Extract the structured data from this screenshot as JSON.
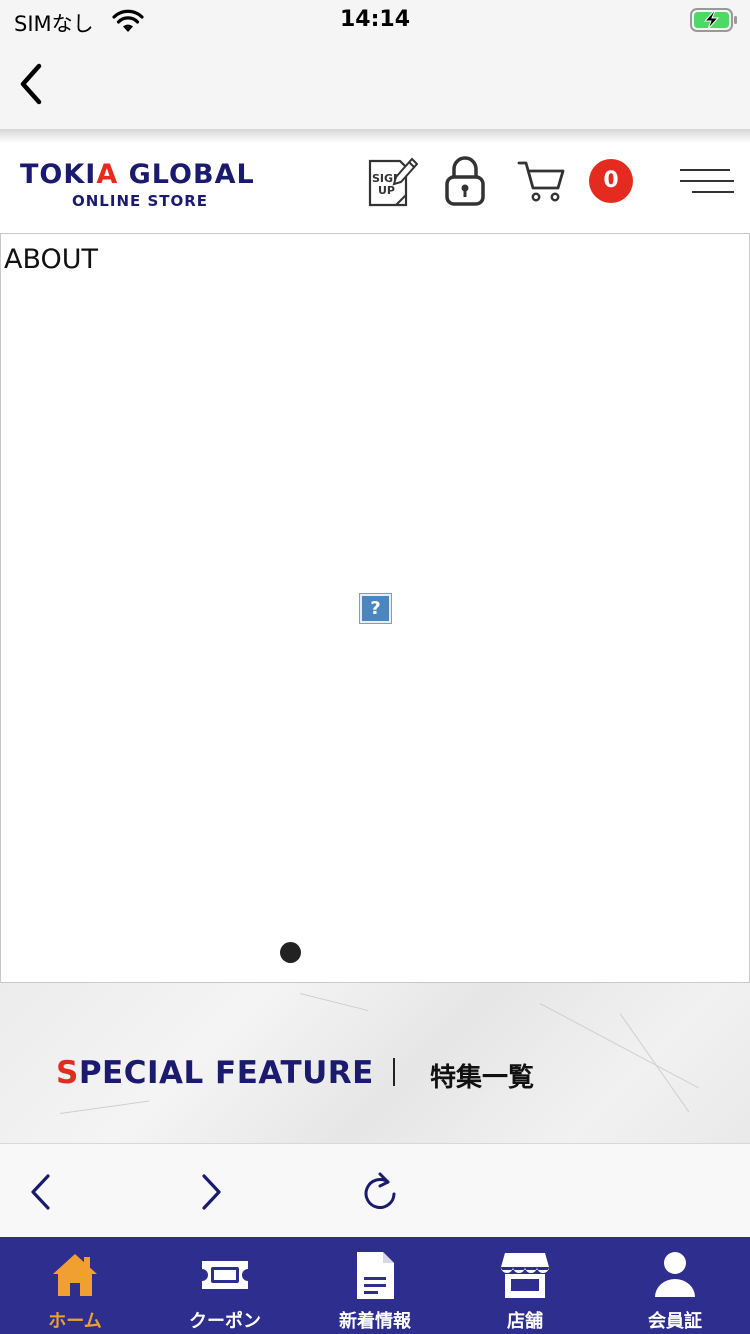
{
  "status_bar": {
    "carrier": "SIMなし",
    "time": "14:14",
    "wifi_icon": "wifi-icon",
    "battery_icon": "battery-charging-icon"
  },
  "nav": {
    "back_icon": "chevron-left-icon"
  },
  "header": {
    "logo_prefix": "TOKI",
    "logo_red_letter": "A",
    "logo_suffix": " GLOBAL",
    "logo_sub": "ONLINE STORE",
    "signup_icon": "sign-up-icon",
    "signup_text_1": "SIGN",
    "signup_text_2": "UP",
    "lock_icon": "lock-icon",
    "cart_icon": "cart-icon",
    "cart_count": "0",
    "menu_icon": "hamburger-menu-icon"
  },
  "about": {
    "title": "ABOUT",
    "broken_image_glyph": "?"
  },
  "special_feature": {
    "title_first": "S",
    "title_rest": "PECIAL FEATURE",
    "link_label": "特集一覧"
  },
  "toolbar": {
    "back_icon": "chevron-left-icon",
    "forward_icon": "chevron-right-icon",
    "reload_icon": "reload-icon"
  },
  "tabbar": {
    "active_color": "#f0a030",
    "background": "#2e2e8f",
    "tabs": [
      {
        "label": "ホーム",
        "icon": "home-icon",
        "active": true
      },
      {
        "label": "クーポン",
        "icon": "coupon-icon",
        "active": false
      },
      {
        "label": "新着情報",
        "icon": "document-icon",
        "active": false
      },
      {
        "label": "店舗",
        "icon": "store-icon",
        "active": false
      },
      {
        "label": "会員証",
        "icon": "person-icon",
        "active": false
      }
    ]
  },
  "colors": {
    "brand_navy": "#1a1a6e",
    "brand_red": "#e52a20"
  }
}
